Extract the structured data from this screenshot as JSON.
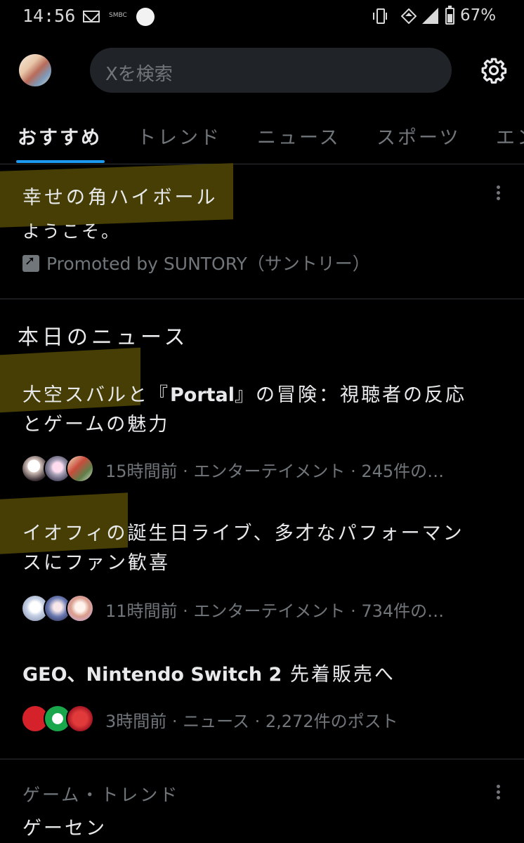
{
  "status_bar": {
    "time": "14:56",
    "carrier_tag": "SMBC",
    "battery": "67%"
  },
  "header": {
    "search_placeholder": "Xを検索",
    "icons": [
      "avatar",
      "settings-gear-icon"
    ]
  },
  "tabs": [
    {
      "label": "おすすめ",
      "active": true
    },
    {
      "label": "トレンド",
      "active": false
    },
    {
      "label": "ニュース",
      "active": false
    },
    {
      "label": "スポーツ",
      "active": false
    },
    {
      "label": "エン",
      "active": false
    }
  ],
  "promo": {
    "title": "幸せの角ハイボール",
    "subtitle": "ようこそ。",
    "promoted_by": "Promoted by SUNTORY（サントリー）"
  },
  "news": {
    "section_title": "本日のニュース",
    "items": [
      {
        "title_line1_a": "大空スバルと『",
        "title_line1_b": "Portal",
        "title_line1_c": "』の冒険：視聴者の反応",
        "title_line2": "とゲームの魅力",
        "meta_time": "15時間前",
        "meta_category": "エンターテイメント",
        "meta_count": "245件の…"
      },
      {
        "title_line1": "イオフィの誕生日ライブ、多才なパフォーマン",
        "title_line2": "スにファン歓喜",
        "meta_time": "11時間前",
        "meta_category": "エンターテイメント",
        "meta_count": "734件の…"
      },
      {
        "title_a": "GEO、Nintendo Switch 2",
        "title_b": " 先着販売へ",
        "meta_time": "3時間前",
        "meta_category": "ニュース",
        "meta_count": "2,272件のポスト"
      }
    ]
  },
  "trend": {
    "category": "ゲーム・トレンド",
    "name": "ゲーセン"
  },
  "colors": {
    "background": "#000000",
    "text": "#e7e9ea",
    "muted": "#71767b",
    "accent": "#1d9bf0",
    "search_bg": "#202327",
    "highlighter": "#4a4104"
  }
}
